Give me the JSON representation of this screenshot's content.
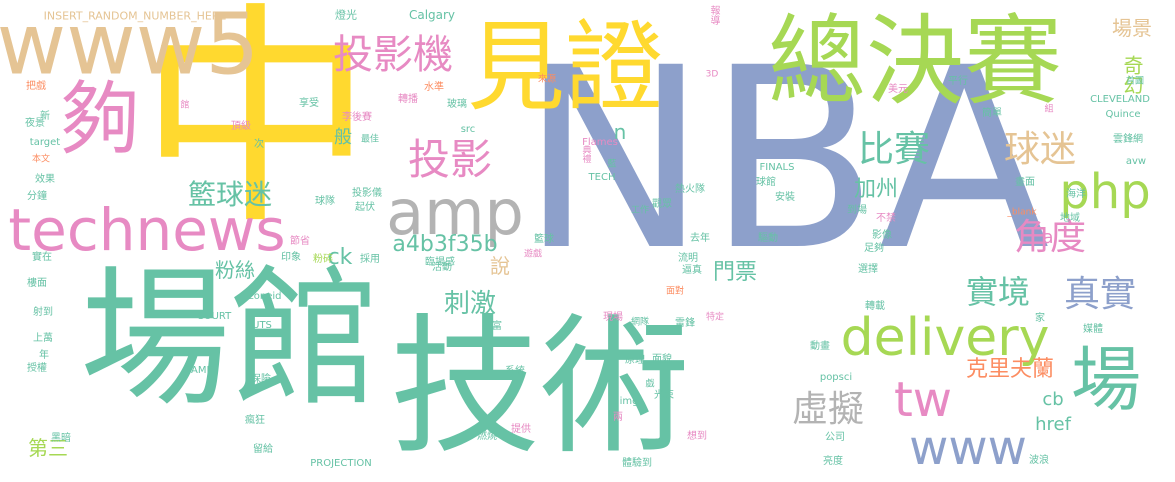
{
  "palette": {
    "teal": "#66c2a5",
    "orange": "#fc8d62",
    "blue": "#8da0cb",
    "pink": "#e78ac3",
    "green": "#a6d854",
    "yellow": "#ffd92f",
    "tan": "#e5c494",
    "gray": "#b3b3b3"
  },
  "words": [
    {
      "text": "NBA",
      "color": "blue"
    },
    {
      "text": "中",
      "color": "yellow"
    },
    {
      "text": "場館",
      "color": "teal"
    },
    {
      "text": "技術",
      "color": "teal"
    },
    {
      "text": "見證",
      "color": "yellow"
    },
    {
      "text": "總決賽",
      "color": "green"
    },
    {
      "text": "www5",
      "color": "tan"
    },
    {
      "text": "夠",
      "color": "pink"
    },
    {
      "text": "場",
      "color": "teal"
    },
    {
      "text": "technews",
      "color": "pink"
    },
    {
      "text": "amp",
      "color": "gray"
    },
    {
      "text": "php",
      "color": "green"
    },
    {
      "text": "delivery",
      "color": "green"
    },
    {
      "text": "投影機",
      "color": "pink"
    },
    {
      "text": "投影",
      "color": "pink"
    },
    {
      "text": "比賽",
      "color": "teal"
    },
    {
      "text": "球迷",
      "color": "tan"
    },
    {
      "text": "角度",
      "color": "pink"
    },
    {
      "text": "真實",
      "color": "blue"
    },
    {
      "text": "實境",
      "color": "teal"
    },
    {
      "text": "虛擬",
      "color": "gray"
    },
    {
      "text": "www",
      "color": "blue"
    },
    {
      "text": "tw",
      "color": "pink"
    },
    {
      "text": "籃球迷",
      "color": "teal"
    },
    {
      "text": "a4b3f35b",
      "color": "teal"
    },
    {
      "text": "刺激",
      "color": "teal"
    },
    {
      "text": "門票",
      "color": "teal"
    },
    {
      "text": "加州",
      "color": "teal"
    },
    {
      "text": "粉絲",
      "color": "teal"
    },
    {
      "text": "克里夫蘭",
      "color": "orange"
    },
    {
      "text": "場景",
      "color": "tan"
    },
    {
      "text": "奇幻",
      "color": "green"
    },
    {
      "text": "ck",
      "color": "teal"
    },
    {
      "text": "cb",
      "color": "teal"
    },
    {
      "text": "href",
      "color": "teal"
    },
    {
      "text": "第三",
      "color": "green"
    },
    {
      "text": "說",
      "color": "tan"
    },
    {
      "text": "般",
      "color": "teal"
    },
    {
      "text": "n",
      "color": "teal"
    },
    {
      "text": "a",
      "color": "pink"
    },
    {
      "text": "INSERT_RANDOM_NUMBER_HERE",
      "color": "tan"
    },
    {
      "text": "燈光",
      "color": "teal"
    },
    {
      "text": "Calgary",
      "color": "teal"
    },
    {
      "text": "報導",
      "color": "pink"
    },
    {
      "text": "美元",
      "color": "pink"
    },
    {
      "text": "平行",
      "color": "teal"
    },
    {
      "text": "首圖",
      "color": "teal"
    },
    {
      "text": "3D",
      "color": "pink"
    },
    {
      "text": "來源",
      "color": "orange"
    },
    {
      "text": "水準",
      "color": "orange"
    },
    {
      "text": "玻璃",
      "color": "teal"
    },
    {
      "text": "轉播",
      "color": "pink"
    },
    {
      "text": "享受",
      "color": "teal"
    },
    {
      "text": "李後賽",
      "color": "pink"
    },
    {
      "text": "最佳",
      "color": "teal"
    },
    {
      "text": "館",
      "color": "pink"
    },
    {
      "text": "新",
      "color": "teal"
    },
    {
      "text": "把戲",
      "color": "orange"
    },
    {
      "text": "夜景",
      "color": "teal"
    },
    {
      "text": "頂級",
      "color": "pink"
    },
    {
      "text": "target",
      "color": "teal"
    },
    {
      "text": "本文",
      "color": "orange"
    },
    {
      "text": "效果",
      "color": "teal"
    },
    {
      "text": "分鐘",
      "color": "teal"
    },
    {
      "text": "src",
      "color": "teal"
    },
    {
      "text": "Flames",
      "color": "pink"
    },
    {
      "text": "TECH",
      "color": "teal"
    },
    {
      "text": "典禮",
      "color": "pink"
    },
    {
      "text": "藍",
      "color": "teal"
    },
    {
      "text": "熱火隊",
      "color": "teal"
    },
    {
      "text": "觀眾",
      "color": "teal"
    },
    {
      "text": "工作",
      "color": "teal"
    },
    {
      "text": "FINALS",
      "color": "teal"
    },
    {
      "text": "球館",
      "color": "teal"
    },
    {
      "text": "安裝",
      "color": "teal"
    },
    {
      "text": "CLEVELAND",
      "color": "teal"
    },
    {
      "text": "Quince",
      "color": "teal"
    },
    {
      "text": "簡單",
      "color": "teal"
    },
    {
      "text": "雲鋒網",
      "color": "teal"
    },
    {
      "text": "avw",
      "color": "teal"
    },
    {
      "text": "畫面",
      "color": "teal"
    },
    {
      "text": "海洋",
      "color": "teal"
    },
    {
      "text": "到場",
      "color": "teal"
    },
    {
      "text": "不禁",
      "color": "pink"
    },
    {
      "text": "_blank",
      "color": "orange"
    },
    {
      "text": "地域",
      "color": "teal"
    },
    {
      "text": "影像",
      "color": "teal"
    },
    {
      "text": "足夠",
      "color": "teal"
    },
    {
      "text": "球隊",
      "color": "teal"
    },
    {
      "text": "投影儀",
      "color": "teal"
    },
    {
      "text": "起伏",
      "color": "teal"
    },
    {
      "text": "節省",
      "color": "pink"
    },
    {
      "text": "採用",
      "color": "teal"
    },
    {
      "text": "籃球",
      "color": "teal"
    },
    {
      "text": "去年",
      "color": "teal"
    },
    {
      "text": "驅動",
      "color": "teal"
    },
    {
      "text": "遊戲",
      "color": "pink"
    },
    {
      "text": "流明",
      "color": "teal"
    },
    {
      "text": "選擇",
      "color": "teal"
    },
    {
      "text": "逼真",
      "color": "teal"
    },
    {
      "text": "臨場感",
      "color": "teal"
    },
    {
      "text": "實在",
      "color": "teal"
    },
    {
      "text": "印象",
      "color": "teal"
    },
    {
      "text": "粉碎",
      "color": "green"
    },
    {
      "text": "活動",
      "color": "teal"
    },
    {
      "text": "樓面",
      "color": "teal"
    },
    {
      "text": "射到",
      "color": "teal"
    },
    {
      "text": "zoneid",
      "color": "teal"
    },
    {
      "text": "COURT",
      "color": "teal"
    },
    {
      "text": "PUTS",
      "color": "teal"
    },
    {
      "text": "現場",
      "color": "pink"
    },
    {
      "text": "網隊",
      "color": "teal"
    },
    {
      "text": "雷鋒",
      "color": "teal"
    },
    {
      "text": "特定",
      "color": "pink"
    },
    {
      "text": "面對",
      "color": "orange"
    },
    {
      "text": "轉載",
      "color": "teal"
    },
    {
      "text": "媒體",
      "color": "teal"
    },
    {
      "text": "家",
      "color": "teal"
    },
    {
      "text": "上萬",
      "color": "teal"
    },
    {
      "text": "興富",
      "color": "teal"
    },
    {
      "text": "年",
      "color": "teal"
    },
    {
      "text": "授權",
      "color": "teal"
    },
    {
      "text": "GAME",
      "color": "teal"
    },
    {
      "text": "保險",
      "color": "teal"
    },
    {
      "text": "系統",
      "color": "teal"
    },
    {
      "text": "原理",
      "color": "teal"
    },
    {
      "text": "面貌",
      "color": "teal"
    },
    {
      "text": "動畫",
      "color": "teal"
    },
    {
      "text": "popsci",
      "color": "teal"
    },
    {
      "text": "戲",
      "color": "teal"
    },
    {
      "text": "img",
      "color": "teal"
    },
    {
      "text": "光束",
      "color": "teal"
    },
    {
      "text": "兩",
      "color": "pink"
    },
    {
      "text": "瘋狂",
      "color": "teal"
    },
    {
      "text": "黑暗",
      "color": "teal"
    },
    {
      "text": "留給",
      "color": "teal"
    },
    {
      "text": "燃燒",
      "color": "teal"
    },
    {
      "text": "提供",
      "color": "pink"
    },
    {
      "text": "PROJECTION",
      "color": "teal"
    },
    {
      "text": "想到",
      "color": "pink"
    },
    {
      "text": "體驗到",
      "color": "teal"
    },
    {
      "text": "公司",
      "color": "teal"
    },
    {
      "text": "亮度",
      "color": "teal"
    },
    {
      "text": "波浪",
      "color": "teal"
    },
    {
      "text": "次",
      "color": "teal"
    },
    {
      "text": "組",
      "color": "pink"
    }
  ]
}
